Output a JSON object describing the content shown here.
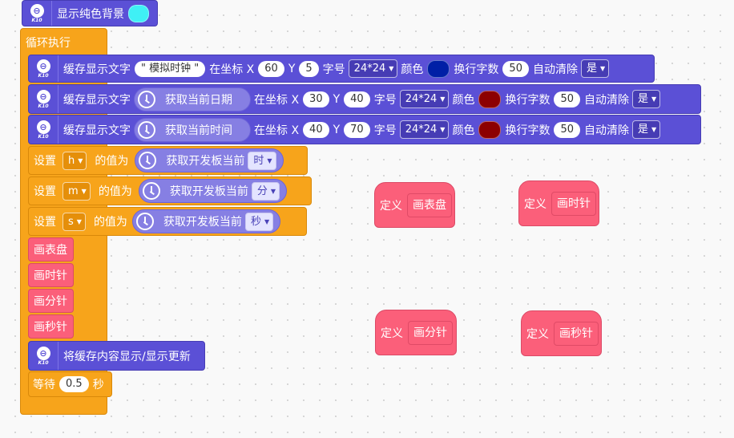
{
  "colors": {
    "block_purple": "#5b50d6",
    "block_orange": "#f7a41b",
    "block_pink": "#fb5f7a",
    "cyan": "#3ff0f5",
    "dark_blue": "#001fa6",
    "dark_red": "#8c0000"
  },
  "board_icon": {
    "badge": "⊖",
    "text": "K10"
  },
  "blocks": {
    "bg": {
      "label": "显示纯色背景"
    },
    "loop": {
      "label": "循环执行"
    },
    "text1": {
      "label": "缓存显示文字",
      "text": "\" 模拟时钟 \"",
      "at": "在坐标 X",
      "x": "60",
      "y_label": "Y",
      "y": "5",
      "size_label": "字号",
      "size": "24*24",
      "color_label": "颜色",
      "wrap_label": "换行字数",
      "wrap": "50",
      "clear_label": "自动清除",
      "clear": "是"
    },
    "text2": {
      "label": "缓存显示文字",
      "reporter": "获取当前日期",
      "at": "在坐标 X",
      "x": "30",
      "y_label": "Y",
      "y": "40",
      "size_label": "字号",
      "size": "24*24",
      "color_label": "颜色",
      "wrap_label": "换行字数",
      "wrap": "50",
      "clear_label": "自动清除",
      "clear": "是"
    },
    "text3": {
      "label": "缓存显示文字",
      "reporter": "获取当前时间",
      "at": "在坐标 X",
      "x": "40",
      "y_label": "Y",
      "y": "70",
      "size_label": "字号",
      "size": "24*24",
      "color_label": "颜色",
      "wrap_label": "换行字数",
      "wrap": "50",
      "clear_label": "自动清除",
      "clear": "是"
    },
    "set_h": {
      "label": "设置",
      "var": "h",
      "value_label": "的值为",
      "reporter": "获取开发板当前",
      "unit": "时"
    },
    "set_m": {
      "label": "设置",
      "var": "m",
      "value_label": "的值为",
      "reporter": "获取开发板当前",
      "unit": "分"
    },
    "set_s": {
      "label": "设置",
      "var": "s",
      "value_label": "的值为",
      "reporter": "获取开发板当前",
      "unit": "秒"
    },
    "call_dial": "画表盘",
    "call_hour": "画时针",
    "call_min": "画分针",
    "call_sec": "画秒针",
    "show_update": {
      "label": "将缓存内容显示/显示更新"
    },
    "wait": {
      "label": "等待",
      "value": "0.5",
      "unit": "秒"
    }
  },
  "definitions": [
    {
      "label": "定义",
      "name": "画表盘"
    },
    {
      "label": "定义",
      "name": "画时针"
    },
    {
      "label": "定义",
      "name": "画分针"
    },
    {
      "label": "定义",
      "name": "画秒针"
    }
  ]
}
